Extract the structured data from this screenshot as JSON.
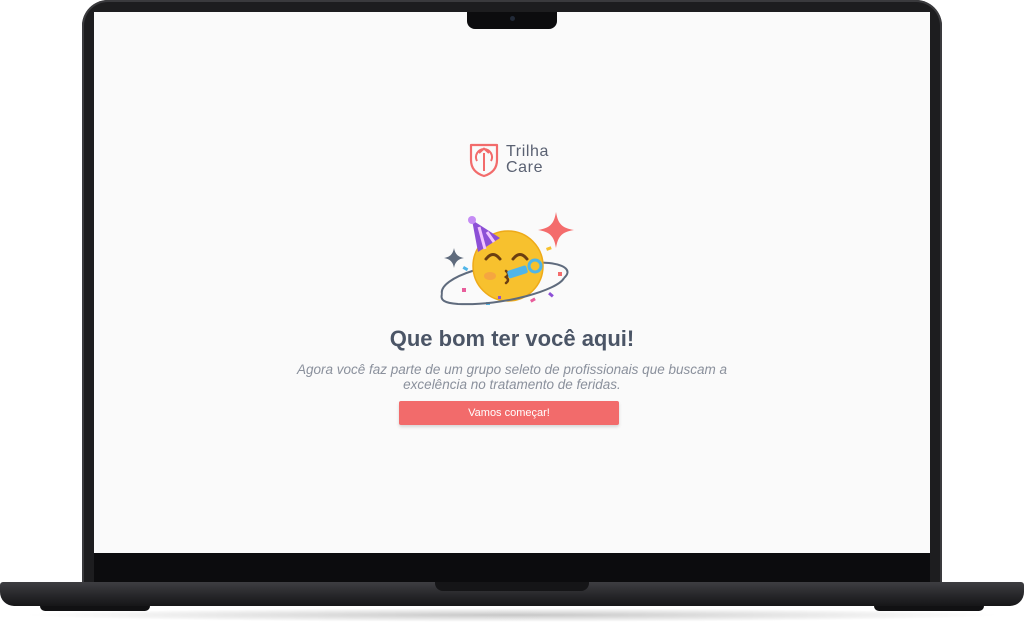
{
  "brand": {
    "name_line1": "Trilha",
    "name_line2": "Care",
    "accent_color": "#f26b6b",
    "logo_icon": "shield-arrow-logo"
  },
  "welcome": {
    "illustration": "partying-face-emoji",
    "headline": "Que bom ter você aqui!",
    "subtitle": "Agora você faz parte de um grupo seleto de profissionais que buscam a excelência no tratamento de feridas.",
    "cta_label": "Vamos começar!"
  },
  "colors": {
    "screen_bg": "#fafafa",
    "headline": "#4b5566",
    "subtitle": "#8a909c",
    "laptop_frame": "#1d1d1f"
  }
}
